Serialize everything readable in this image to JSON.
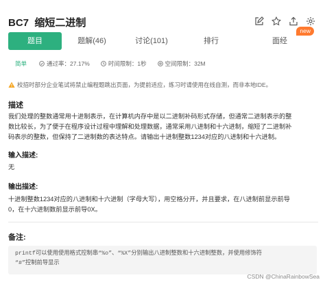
{
  "problem": {
    "id": "BC7",
    "name": "缩短二进制"
  },
  "header_actions": [
    {
      "icon": "edit-icon"
    },
    {
      "icon": "star-icon"
    },
    {
      "icon": "upload-icon"
    },
    {
      "icon": "settings-icon"
    }
  ],
  "tabs": [
    {
      "label": "题目",
      "active": true
    },
    {
      "label": "题解(46)"
    },
    {
      "label": "讨论(101)"
    },
    {
      "label": "排行"
    },
    {
      "label": "面经",
      "badge": "new"
    }
  ],
  "meta": {
    "difficulty": "简单",
    "pass_rate": "通过率：27.17%",
    "time_limit": "时间限制：1秒",
    "memory_limit": "空间限制：32M"
  },
  "warning": "校招时部分企业笔试将禁止编程题跳出页面，为提前适应，练习时请使用在线自测，而非本地IDE。",
  "description": {
    "heading": "描述",
    "lines": [
      "我们处理的整数通常用十进制表示，在计算机内存中是以二进制补码形式存储，但通常二进制表示的整",
      "数比较长，为了便于在程序设计过程中理解和处理数据，通常采用八进制和十六进制，缩短了二进制补",
      "码表示的整数，但保持了二进制数的表达特点。请输出十进制整数1234对应的八进制和十六进制。"
    ]
  },
  "input_desc": {
    "heading": "输入描述:",
    "text": "无"
  },
  "output_desc": {
    "heading": "输出描述:",
    "lines": [
      "十进制整数1234对应的八进制和十六进制（字母大写），用空格分开，并且要求，在八进制前显示前导",
      "0，在十六进制数前显示前导0X。"
    ]
  },
  "notes": {
    "heading": "备注:",
    "lines": [
      "printf可以使用使用格式控制串“%o”、“%X”分别输出八进制整数和十六进制整数，并使用修饰符",
      "“#”控制前导显示"
    ]
  },
  "watermark": "CSDN @ChinaRainbowSea",
  "colors": {
    "accent": "#2db07f",
    "badge": "#ff7a2f",
    "warning_icon": "#f5a623"
  }
}
